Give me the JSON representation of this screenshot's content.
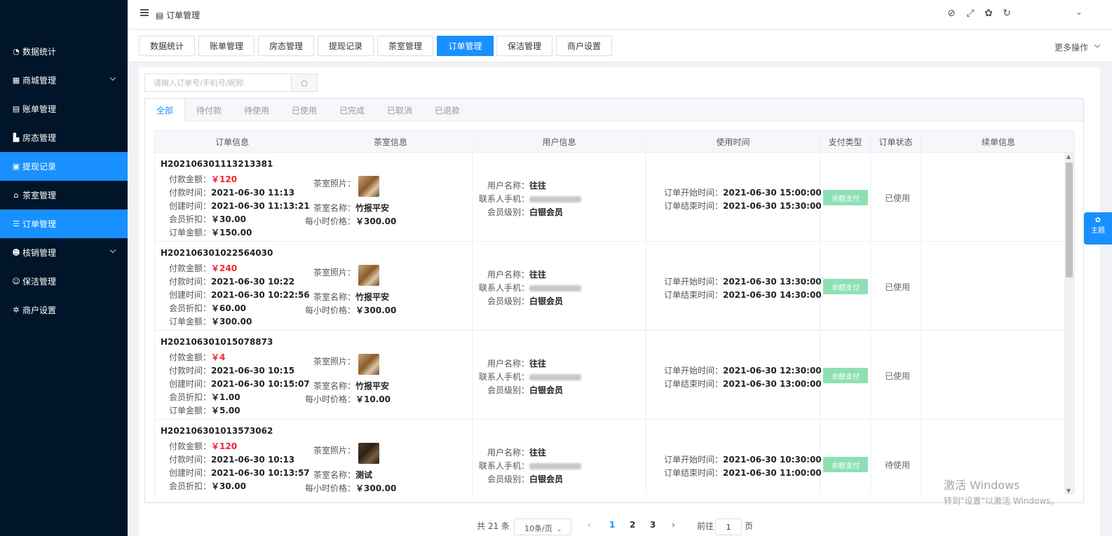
{
  "header": {
    "title_icon": "table-icon",
    "title": "订单管理"
  },
  "sidebar": {
    "items": [
      {
        "label": "数据统计",
        "icon": "dashboard-icon"
      },
      {
        "label": "商城管理",
        "icon": "shop-icon"
      },
      {
        "label": "账单管理",
        "icon": "bill-icon"
      },
      {
        "label": "房态管理",
        "icon": "room-chart-icon"
      },
      {
        "label": "提现记录",
        "icon": "cash-icon"
      },
      {
        "label": "茶室管理",
        "icon": "home-icon"
      },
      {
        "label": "订单管理",
        "icon": "list-icon"
      },
      {
        "label": "核销管理",
        "icon": "users-icon"
      },
      {
        "label": "保洁管理",
        "icon": "user-icon"
      },
      {
        "label": "商户设置",
        "icon": "gear-icon"
      }
    ]
  },
  "nav_tabs": [
    {
      "label": "数据统计"
    },
    {
      "label": "账单管理"
    },
    {
      "label": "房态管理"
    },
    {
      "label": "提现记录"
    },
    {
      "label": "茶室管理"
    },
    {
      "label": "订单管理"
    },
    {
      "label": "保洁管理"
    },
    {
      "label": "商户设置"
    }
  ],
  "more_ops": "更多操作",
  "search": {
    "placeholder": "请输入订单号/手机号/昵称"
  },
  "status_tabs": [
    {
      "label": "全部"
    },
    {
      "label": "待付款"
    },
    {
      "label": "待使用"
    },
    {
      "label": "已使用"
    },
    {
      "label": "已完成"
    },
    {
      "label": "已取消"
    },
    {
      "label": "已退款"
    }
  ],
  "columns": [
    "订单信息",
    "茶室信息",
    "用户信息",
    "使用时间",
    "支付类型",
    "订单状态",
    "续单信息"
  ],
  "labels": {
    "pay_amount": "付款金额：",
    "pay_time": "付款时间：",
    "create_time": "创建时间：",
    "discount": "会员折扣：",
    "order_amount": "订单金额：",
    "room_photo": "茶室照片：",
    "room_name": "茶室名称：",
    "hourly_price": "每小时价格：",
    "user_name": "用户名称：",
    "user_phone": "联系人手机：",
    "member_level": "会员级别：",
    "start_time": "订单开始时间：",
    "end_time": "订单结束时间："
  },
  "orders": [
    {
      "order_no": "H202106301113213381",
      "pay_amount": "￥120",
      "pay_time": "2021-06-30 11:13",
      "create_time": "2021-06-30 11:13:21",
      "discount": "￥30.00",
      "order_amount": "￥150.00",
      "room_name": "竹报平安",
      "hourly_price": "￥300.00",
      "user_name": "往往",
      "member_level": "白银会员",
      "start_time": "2021-06-30 15:00:00",
      "end_time": "2021-06-30 15:30:00",
      "pay_type": "余额支付",
      "status": "已使用"
    },
    {
      "order_no": "H202106301022564030",
      "pay_amount": "￥240",
      "pay_time": "2021-06-30 10:22",
      "create_time": "2021-06-30 10:22:56",
      "discount": "￥60.00",
      "order_amount": "￥300.00",
      "room_name": "竹报平安",
      "hourly_price": "￥300.00",
      "user_name": "往往",
      "member_level": "白银会员",
      "start_time": "2021-06-30 13:30:00",
      "end_time": "2021-06-30 14:30:00",
      "pay_type": "余额支付",
      "status": "已使用"
    },
    {
      "order_no": "H202106301015078873",
      "pay_amount": "￥4",
      "pay_time": "2021-06-30 10:15",
      "create_time": "2021-06-30 10:15:07",
      "discount": "￥1.00",
      "order_amount": "￥5.00",
      "room_name": "竹报平安",
      "hourly_price": "￥10.00",
      "user_name": "往往",
      "member_level": "白银会员",
      "start_time": "2021-06-30 12:30:00",
      "end_time": "2021-06-30 13:00:00",
      "pay_type": "余额支付",
      "status": "已使用"
    },
    {
      "order_no": "H202106301013573062",
      "pay_amount": "￥120",
      "pay_time": "2021-06-30 10:13",
      "create_time": "2021-06-30 10:13:57",
      "discount": "￥30.00",
      "order_amount": "",
      "room_name": "测试",
      "hourly_price": "￥300.00",
      "user_name": "往往",
      "member_level": "白银会员",
      "start_time": "2021-06-30 10:30:00",
      "end_time": "2021-06-30 11:00:00",
      "pay_type": "余额支付",
      "status": "待使用"
    }
  ],
  "pager": {
    "total": "共 21 条",
    "page_size": "10条/页",
    "pages": [
      "1",
      "2",
      "3"
    ],
    "current": "1",
    "goto_label": "前往",
    "goto_value": "1",
    "page_unit": "页"
  },
  "float_btn": {
    "label": "主题"
  },
  "watermark": {
    "line1": "激活 Windows",
    "line2": "转到\"设置\"以激活 Windows。"
  }
}
